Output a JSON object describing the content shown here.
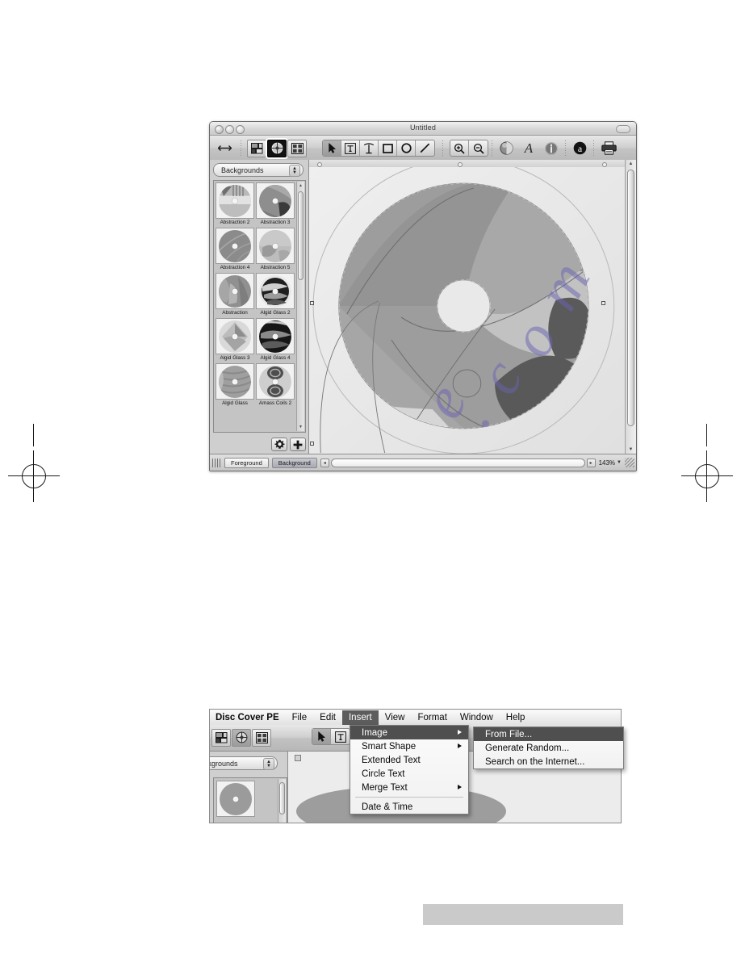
{
  "app": {
    "name": "Disc Cover PE",
    "window_title": "Untitled"
  },
  "menubar": {
    "items": [
      {
        "label": "Disc Cover PE",
        "selected": false
      },
      {
        "label": "File",
        "selected": false
      },
      {
        "label": "Edit",
        "selected": false
      },
      {
        "label": "Insert",
        "selected": true
      },
      {
        "label": "View",
        "selected": false
      },
      {
        "label": "Format",
        "selected": false
      },
      {
        "label": "Window",
        "selected": false
      },
      {
        "label": "Help",
        "selected": false
      }
    ]
  },
  "insert_menu": {
    "items": [
      {
        "label": "Image",
        "submenu": true,
        "highlighted": true
      },
      {
        "label": "Smart Shape",
        "submenu": true,
        "highlighted": false
      },
      {
        "label": "Extended Text",
        "submenu": false,
        "highlighted": false
      },
      {
        "label": "Circle Text",
        "submenu": false,
        "highlighted": false
      },
      {
        "label": "Merge Text",
        "submenu": true,
        "highlighted": false
      },
      {
        "label": "Date & Time",
        "submenu": false,
        "highlighted": false,
        "separator_before": true
      }
    ]
  },
  "image_submenu": {
    "items": [
      {
        "label": "From File...",
        "highlighted": true
      },
      {
        "label": "Generate Random...",
        "highlighted": false
      },
      {
        "label": "Search on the Internet...",
        "highlighted": false
      }
    ]
  },
  "toolbar": {
    "view_modes": [
      {
        "name": "layout-view",
        "selected": false
      },
      {
        "name": "disc-view",
        "selected": true
      },
      {
        "name": "grid-view",
        "selected": false
      }
    ],
    "tools": [
      {
        "name": "arrow-tool",
        "selected": true
      },
      {
        "name": "text-tool",
        "selected": false
      },
      {
        "name": "circle-text-tool",
        "selected": false
      },
      {
        "name": "rectangle-tool",
        "selected": false
      },
      {
        "name": "ellipse-tool",
        "selected": false
      },
      {
        "name": "line-tool",
        "selected": false
      }
    ],
    "zoom_tools": [
      {
        "name": "zoom-in-tool"
      },
      {
        "name": "zoom-out-tool"
      }
    ],
    "inspectors": [
      {
        "name": "colors-icon"
      },
      {
        "name": "fonts-icon"
      },
      {
        "name": "info-icon"
      },
      {
        "name": "smart-text-icon"
      },
      {
        "name": "print-icon"
      }
    ],
    "resize_handle": "resize-icon"
  },
  "sidebar": {
    "category_label": "Backgrounds",
    "thumbnails": [
      {
        "label": "Abstraction 2"
      },
      {
        "label": "Abstraction 3"
      },
      {
        "label": "Abstraction 4"
      },
      {
        "label": "Abstraction 5"
      },
      {
        "label": "Abstraction"
      },
      {
        "label": "Algid Glass 2"
      },
      {
        "label": "Algid Glass 3"
      },
      {
        "label": "Algid Glass 4"
      },
      {
        "label": "Algid Glass"
      },
      {
        "label": "Amass Coils 2"
      }
    ],
    "action_buttons": [
      {
        "name": "settings-gear-button",
        "glyph": "gear"
      },
      {
        "name": "add-button",
        "glyph": "plus"
      }
    ]
  },
  "statusbar": {
    "layers": [
      {
        "label": "Foreground",
        "active": false
      },
      {
        "label": "Background",
        "active": true
      }
    ],
    "zoom_level": "143%",
    "zoom_out_glyph": "◂",
    "zoom_in_glyph": "▸"
  },
  "colors": {
    "menu_highlight": "#4f4f4f",
    "menubar_selected": "#5d5d5d",
    "window_chrome": "#d9d9d9",
    "canvas_bg": "#e9e9e9",
    "watermark": "#6a63b4"
  }
}
